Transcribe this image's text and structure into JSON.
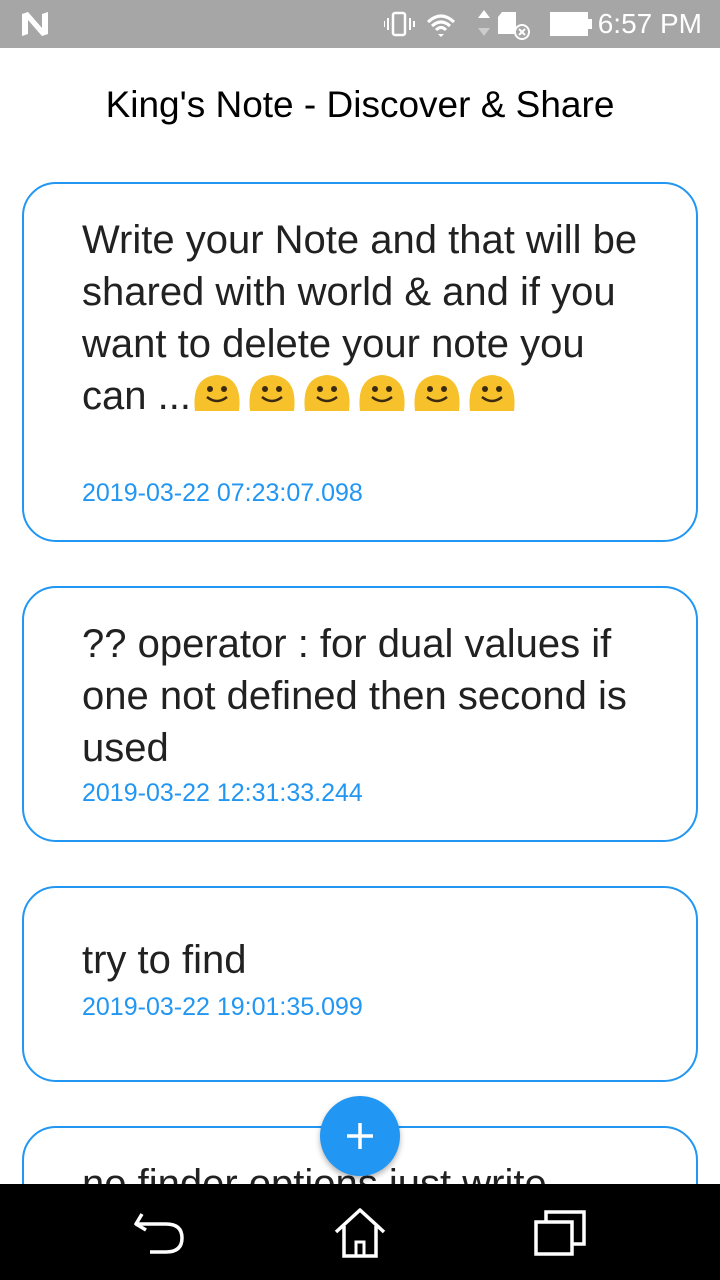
{
  "status_bar": {
    "time": "6:57 PM",
    "icons": [
      "n-logo-icon",
      "vibrate-icon",
      "wifi-icon",
      "data-arrows-icon",
      "sd-card-icon",
      "battery-icon"
    ]
  },
  "app_bar": {
    "title": "King's Note - Discover & Share"
  },
  "notes": [
    {
      "text": "Write your Note and that will be shared with world & and if you want to delete your note you can ...",
      "emoji_count": 6,
      "date": "2019-03-22 07:23:07.098"
    },
    {
      "text": "?? operator : for dual values if one not defined then second is used",
      "date": "2019-03-22 12:31:33.244"
    },
    {
      "text": "try to find",
      "date": "2019-03-22 19:01:35.099"
    },
    {
      "text": "no finder options just write"
    }
  ],
  "fab": {
    "icon": "plus-icon"
  },
  "nav_bar": {
    "icons": [
      "back-icon",
      "home-icon",
      "recent-apps-icon"
    ]
  },
  "colors": {
    "accent": "#2196f3",
    "status_bar": "#a6a6a6",
    "nav_bar": "#000000",
    "note_text": "#212121"
  }
}
